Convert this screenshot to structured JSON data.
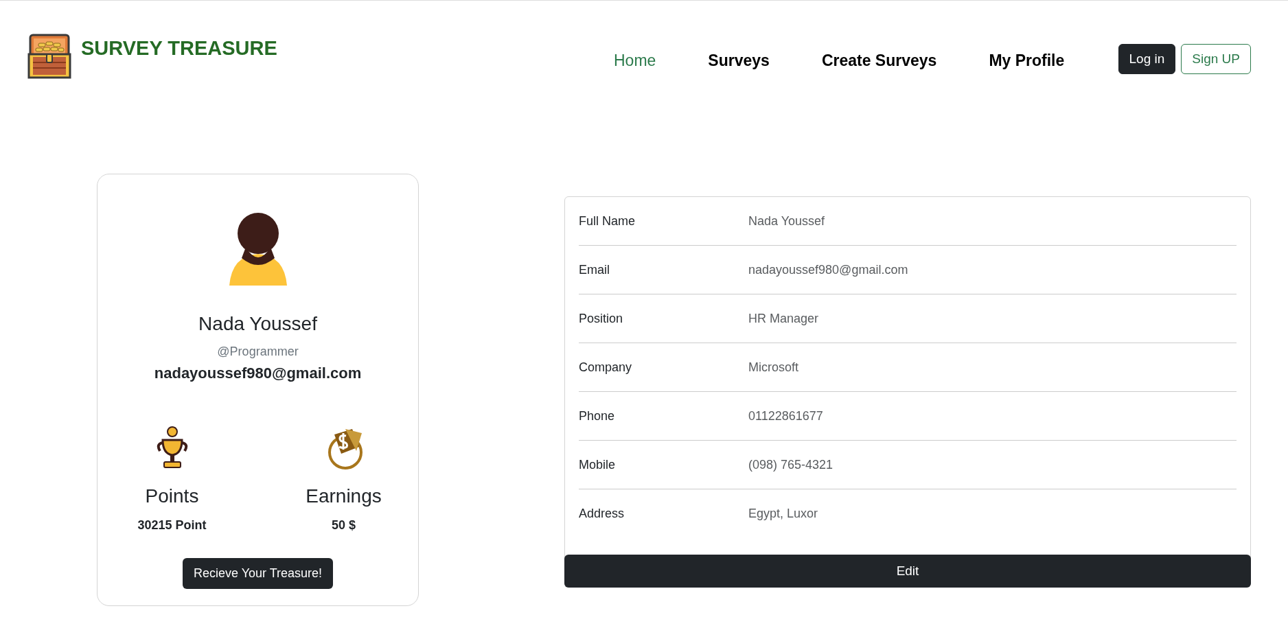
{
  "brand": {
    "title": "SURVEY TREASURE"
  },
  "nav": {
    "links": [
      {
        "label": "Home",
        "selected": true
      },
      {
        "label": "Surveys",
        "selected": false
      },
      {
        "label": "Create Surveys",
        "selected": false
      },
      {
        "label": "My Profile",
        "selected": false
      }
    ],
    "buttons": [
      {
        "label": "Log in",
        "kind": "solid"
      },
      {
        "label": "Sign UP",
        "kind": "outline"
      }
    ]
  },
  "profile": {
    "name": "Nada Youssef",
    "handle": "@Programmer",
    "email": "nadayoussef980@gmail.com",
    "stats": [
      {
        "kind": "trophy",
        "title": "Points",
        "value": "30215 Point"
      },
      {
        "kind": "money",
        "title": "Earnings",
        "value": "50 $"
      }
    ],
    "action": "Recieve Your Treasure!"
  },
  "details": {
    "rows": [
      {
        "label": "Full Name",
        "value": "Nada Youssef"
      },
      {
        "label": "Email",
        "value": "nadayoussef980@gmail.com"
      },
      {
        "label": "Position",
        "value": "HR Manager"
      },
      {
        "label": "Company",
        "value": "Microsoft"
      },
      {
        "label": "Phone",
        "value": "01122861677"
      },
      {
        "label": "Mobile",
        "value": "(098) 765-4321"
      },
      {
        "label": "Address",
        "value": "Egypt, Luxor"
      }
    ],
    "edit": "Edit"
  }
}
